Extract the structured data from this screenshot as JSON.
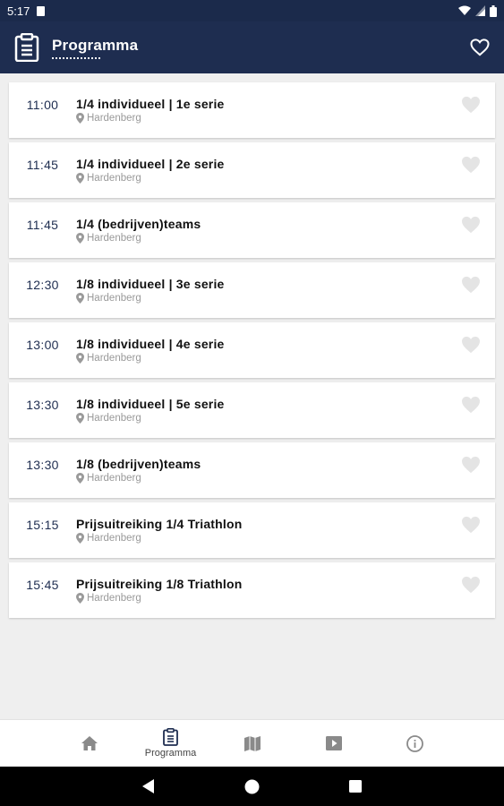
{
  "status_bar": {
    "time": "5:17"
  },
  "app_bar": {
    "title": "Programma"
  },
  "events": [
    {
      "time": "11:00",
      "title": "1/4 individueel | 1e serie",
      "location": "Hardenberg"
    },
    {
      "time": "11:45",
      "title": "1/4 individueel | 2e serie",
      "location": "Hardenberg"
    },
    {
      "time": "11:45",
      "title": "1/4 (bedrijven)teams",
      "location": "Hardenberg"
    },
    {
      "time": "12:30",
      "title": "1/8 individueel | 3e serie",
      "location": "Hardenberg"
    },
    {
      "time": "13:00",
      "title": "1/8 individueel | 4e serie",
      "location": "Hardenberg"
    },
    {
      "time": "13:30",
      "title": "1/8 individueel | 5e serie",
      "location": "Hardenberg"
    },
    {
      "time": "13:30",
      "title": "1/8 (bedrijven)teams",
      "location": "Hardenberg"
    },
    {
      "time": "15:15",
      "title": "Prijsuitreiking 1/4 Triathlon",
      "location": "Hardenberg"
    },
    {
      "time": "15:45",
      "title": "Prijsuitreiking 1/8 Triathlon",
      "location": "Hardenberg"
    }
  ],
  "bottom_nav": {
    "items": [
      {
        "icon": "home-icon",
        "label": ""
      },
      {
        "icon": "clipboard-icon",
        "label": "Programma",
        "active": true
      },
      {
        "icon": "map-icon",
        "label": ""
      },
      {
        "icon": "play-icon",
        "label": ""
      },
      {
        "icon": "info-icon",
        "label": ""
      }
    ]
  },
  "colors": {
    "primary": "#1e2d50",
    "time_text": "#1e2d50",
    "location_text": "#9a9a9a",
    "heart_outline": "#d9d9d9"
  }
}
